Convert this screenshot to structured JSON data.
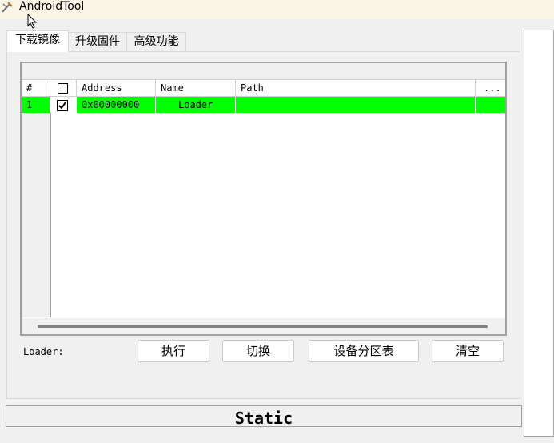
{
  "window": {
    "title": "AndroidTool"
  },
  "tabs": [
    {
      "label": "下载镜像"
    },
    {
      "label": "升级固件"
    },
    {
      "label": "高级功能"
    }
  ],
  "table": {
    "columns": {
      "num": "#",
      "address": "Address",
      "name": "Name",
      "path": "Path",
      "more": "..."
    },
    "rows": [
      {
        "num": "1",
        "checked": true,
        "address": "0x00000000",
        "name": "Loader",
        "path": ""
      }
    ],
    "row_highlight_color": "#00ff00"
  },
  "footer": {
    "loader_label": "Loader:",
    "buttons": {
      "run": "执行",
      "switch": "切换",
      "partition": "设备分区表",
      "clear": "清空"
    }
  },
  "status": {
    "text": "Static"
  }
}
